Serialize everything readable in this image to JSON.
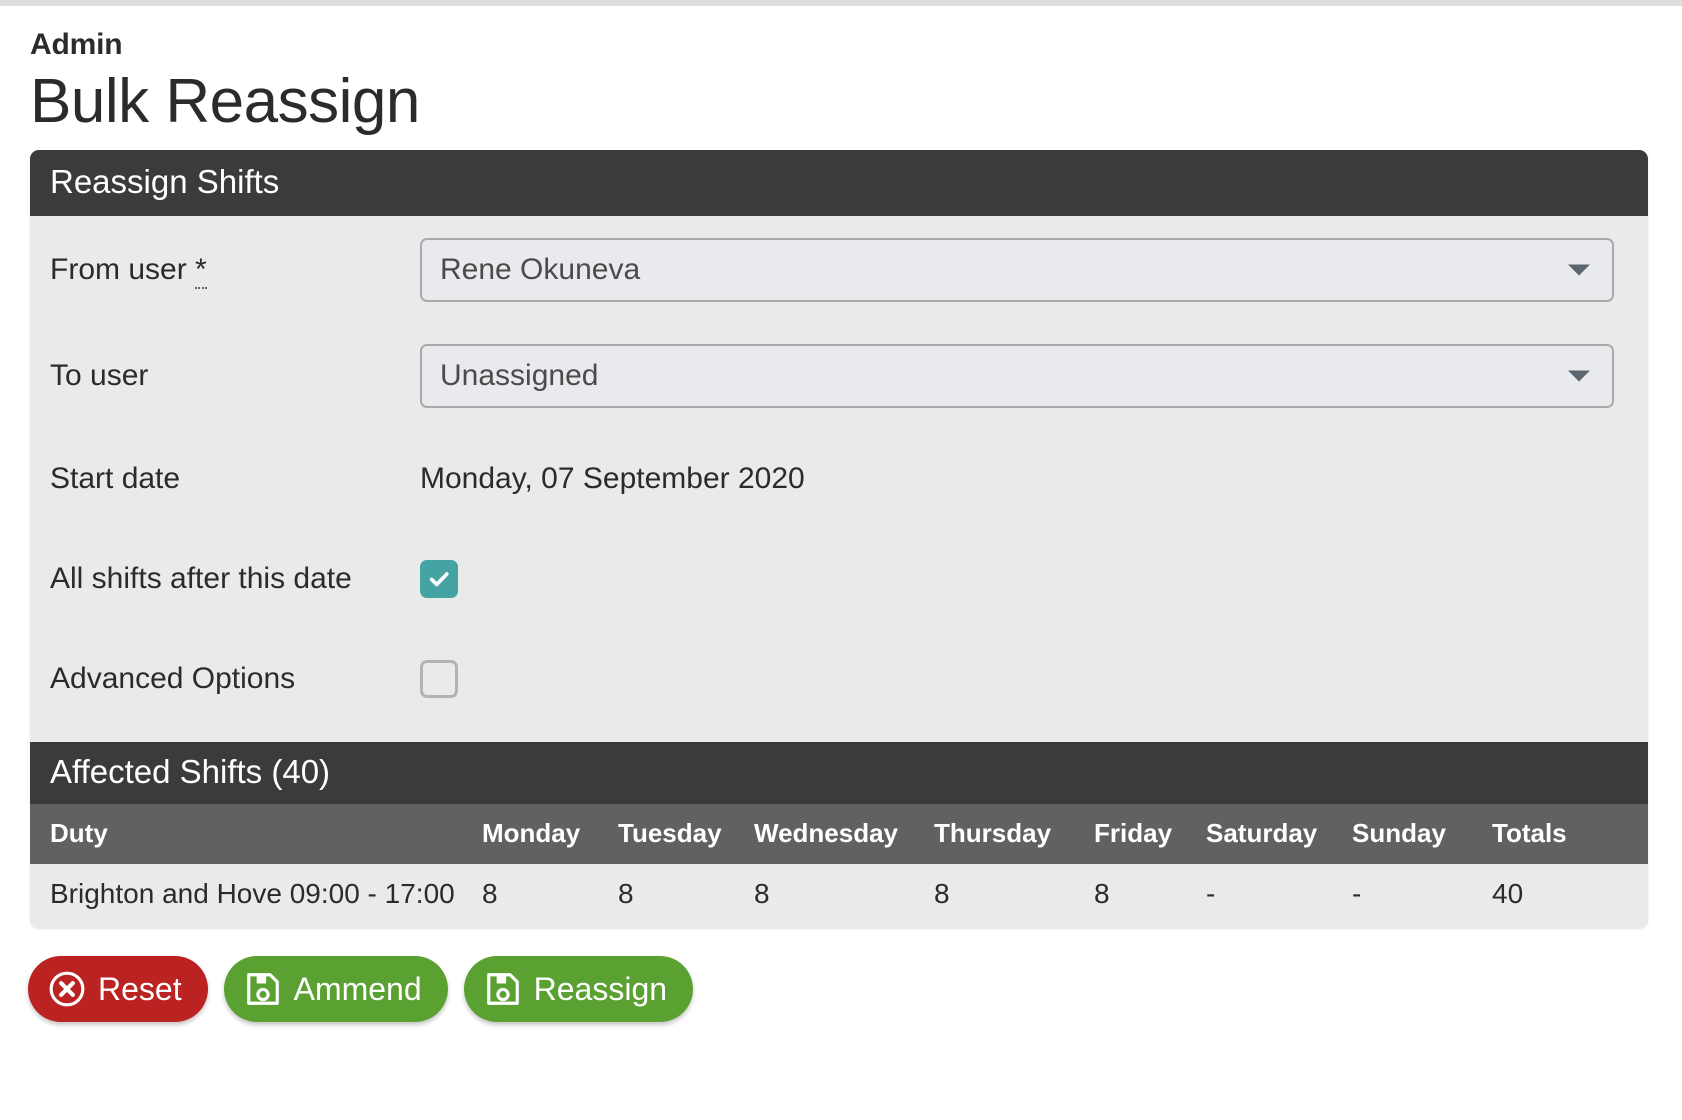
{
  "header": {
    "eyebrow": "Admin",
    "title": "Bulk Reassign"
  },
  "card": {
    "title": "Reassign Shifts",
    "fields": {
      "from_user": {
        "label": "From user",
        "required_marker": "*",
        "value": "Rene Okuneva",
        "control": "select"
      },
      "to_user": {
        "label": "To user",
        "value": "Unassigned",
        "control": "select"
      },
      "start_date": {
        "label": "Start date",
        "value": "Monday, 07 September 2020",
        "control": "static-text"
      },
      "all_shifts_after": {
        "label": "All shifts after this date",
        "checked": true,
        "control": "checkbox"
      },
      "advanced_options": {
        "label": "Advanced Options",
        "checked": false,
        "control": "checkbox"
      }
    }
  },
  "affected": {
    "title": "Affected Shifts (40)",
    "columns": [
      "Duty",
      "Monday",
      "Tuesday",
      "Wednesday",
      "Thursday",
      "Friday",
      "Saturday",
      "Sunday",
      "Totals"
    ],
    "rows": [
      {
        "duty": "Brighton and Hove 09:00 - 17:00",
        "monday": "8",
        "tuesday": "8",
        "wednesday": "8",
        "thursday": "8",
        "friday": "8",
        "saturday": "-",
        "sunday": "-",
        "totals": "40"
      }
    ]
  },
  "buttons": {
    "reset": {
      "label": "Reset",
      "icon": "times-circle-icon"
    },
    "ammend": {
      "label": "Ammend",
      "icon": "save-floppy-icon"
    },
    "reassign": {
      "label": "Reassign",
      "icon": "save-floppy-icon"
    }
  },
  "colors": {
    "header_dark": "#3c3a3a",
    "table_header": "#636160",
    "panel": "#ebeaea",
    "checkbox_on": "#45a3a3",
    "danger": "#bb2222",
    "success": "#5aa132"
  }
}
